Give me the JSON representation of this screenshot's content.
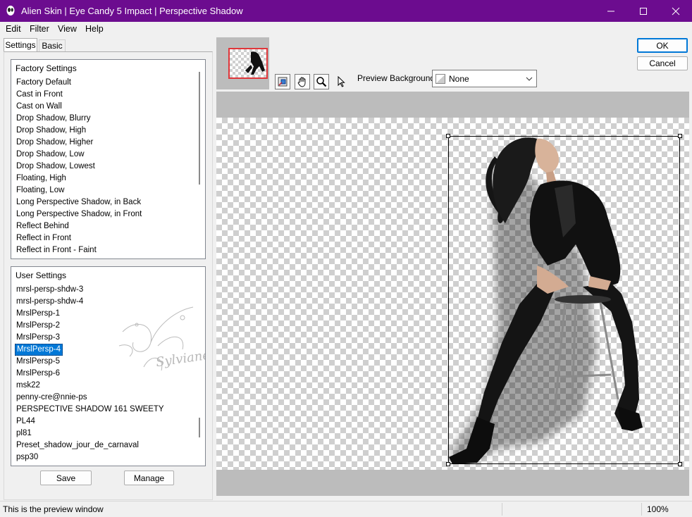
{
  "window": {
    "title": "Alien Skin | Eye Candy 5 Impact | Perspective Shadow",
    "controls": [
      "minimize",
      "maximize",
      "close"
    ]
  },
  "menu": [
    "Edit",
    "Filter",
    "View",
    "Help"
  ],
  "tabs": [
    {
      "label": "Settings",
      "active": true
    },
    {
      "label": "Basic",
      "active": false
    }
  ],
  "factory_settings": {
    "header": "Factory Settings",
    "items": [
      "Factory Default",
      "Cast in Front",
      "Cast on Wall",
      "Drop Shadow, Blurry",
      "Drop Shadow, High",
      "Drop Shadow, Higher",
      "Drop Shadow, Low",
      "Drop Shadow, Lowest",
      "Floating, High",
      "Floating, Low",
      "Long Perspective Shadow, in Back",
      "Long Perspective Shadow, in Front",
      "Reflect Behind",
      "Reflect in Front",
      "Reflect in Front - Faint"
    ]
  },
  "user_settings": {
    "header": "User Settings",
    "items": [
      "mrsl-persp-shdw-3",
      "mrsl-persp-shdw-4",
      "MrslPersp-1",
      "MrslPersp-2",
      "MrslPersp-3",
      "MrslPersp-4",
      "MrslPersp-5",
      "MrslPersp-6",
      "msk22",
      "penny-cre@nnie-ps",
      "PERSPECTIVE SHADOW 161 SWEETY",
      "PL44",
      "pl81",
      "Preset_shadow_jour_de_carnaval",
      "psp30"
    ],
    "selected": "MrslPersp-4"
  },
  "buttons": {
    "save": "Save",
    "manage": "Manage",
    "ok": "OK",
    "cancel": "Cancel"
  },
  "toolbar": {
    "tools": [
      "navigator-icon",
      "hand-icon",
      "zoom-icon",
      "pointer-icon"
    ],
    "preview_background_label": "Preview Background:",
    "preview_background_value": "None"
  },
  "status": {
    "message": "This is the preview window",
    "zoom": "100%"
  },
  "watermark": "Sylviane",
  "colors": {
    "titlebar": "#6c0c8f",
    "selection": "#0078d7",
    "preview_gray": "#bcbcbc"
  }
}
